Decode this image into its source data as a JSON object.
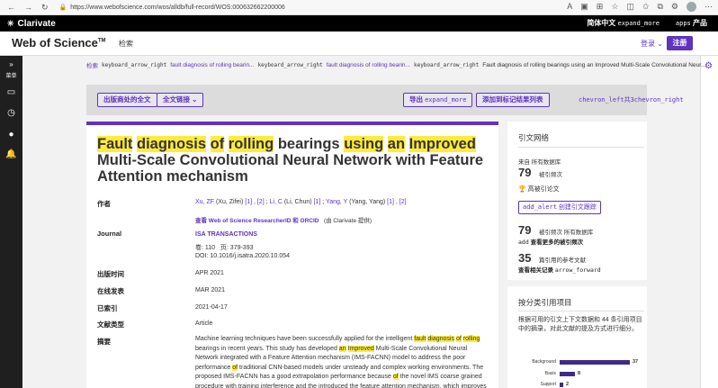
{
  "browser": {
    "url": "https://www.webofscience.com/wos/alldb/full-record/WOS:000632662200006"
  },
  "clarivate": {
    "logo": "Clarivate",
    "lang_label": "简体中文",
    "lang_icon": "expand_more",
    "apps_icon": "apps",
    "apps_label": "产品"
  },
  "header": {
    "logo": "Web of Science",
    "logo_tm": "TM",
    "search_nav": "检索",
    "login_label": "登录",
    "register_label": "注册"
  },
  "sidebar": {
    "menu_label": "菜单"
  },
  "breadcrumb": {
    "home": "检索",
    "sep1": "keyboard_arrow_right",
    "crumb1": "fault diagnosis of rolling bearin...",
    "sep2": "keyboard_arrow_right",
    "crumb2": "fault diagnosis of rolling bearin...",
    "sep3": "keyboard_arrow_right",
    "current": "Fault diagnosis of rolling bearings using an Improved Multi-Scale Convolutional Neur..."
  },
  "toolbar": {
    "publisher_fulltext": "出版商处的全文",
    "fulltext_links": "全文链接",
    "export": "导出",
    "export_icon": "expand_more",
    "add_marked": "添加到标记结果列表",
    "pager": "chevron_left共3chevron_right"
  },
  "record": {
    "title_parts": {
      "p1": "Fault",
      "p2": "diagnosis",
      "p3": "of",
      "p4": "rolling",
      "p5": "bearings",
      "p6": "using",
      "p7": "an",
      "p8": "Improved",
      "p9": "Multi-Scale Convolutional Neural Network with Feature Attention mechanism"
    },
    "authors_label": "作者",
    "authors": {
      "a1": "Xu, ZF",
      "a1_full": " (Xu, Zifei) ",
      "a1_refs": "[1] , [2]",
      "a2": "Li, C",
      "a2_full": " (Li, Chun) ",
      "a2_refs": "[1]",
      "a3": "Yang, Y",
      "a3_full": " (Yang, Yang) ",
      "a3_refs": "[1] , [2]",
      "researcher_link": "查看 Web of Science ResearcherID 和 ORCID",
      "provider": "(由 Clarivate 提供)"
    },
    "journal_label": "Journal",
    "journal_name": "ISA TRANSACTIONS",
    "volume": "卷: 110",
    "pages": "页: 379-393",
    "doi": "DOI: 10.1016/j.isatra.2020.10.054",
    "pub_date_label": "出版时间",
    "pub_date": "APR 2021",
    "early_access_label": "在线发表",
    "early_access": "MAR 2021",
    "indexed_label": "已索引",
    "indexed": "2021-04-17",
    "doc_type_label": "文献类型",
    "doc_type": "Article",
    "abstract_label": "摘要",
    "abstract": {
      "t1": "Machine learning techniques have been successfully applied for the intelligent ",
      "h1": "fault",
      "t2": " ",
      "h2": "diagnosis",
      "t3": " ",
      "h3": "of",
      "t4": " ",
      "h4": "rolling",
      "t5": " bearings in recent years. This study has developed ",
      "h5": "an",
      "t6": " ",
      "h6": "Improved",
      "t7": " Multi-Scale Convolutional Neural Network integrated with a Feature Attention mechanism (IMS-FACNN) model to address the poor performance ",
      "h7": "of",
      "t8": " traditional CNN-based models under unsteady and complex working environments. The proposed IMS-FACNN has a good extrapolation performance because ",
      "h8": "of",
      "t9": " the novel IMS coarse grained procedure with training interference and the introduced the feature attention mechanism, which improves the model's generalization ability. The proposed IMS-FACNN"
    }
  },
  "citation": {
    "title": "引文网络",
    "source_label": "来自 所有数据库",
    "times_cited": "79",
    "times_cited_label": "被引频次",
    "highly_cited": "高被引论文",
    "alert_icon": "add_alert",
    "alert_label": "创建引文跟踪",
    "all_db_count": "79",
    "all_db_label": "被引频次 所有数据库",
    "more_counts_icon": "add",
    "more_counts_label": "查看更多的被引频次",
    "refs_count": "35",
    "refs_label": "篇引用的参考文献",
    "related_label": "查看相关记录",
    "related_icon": "arrow_forward"
  },
  "classified": {
    "title": "按分类引用项目",
    "desc": "根据可用的引文上下文数据和 44 条引用项目中的摘录，对此文献的提及方式进行细分。",
    "bars": [
      {
        "label": "Background",
        "value": 37
      },
      {
        "label": "Basis",
        "value": 8
      },
      {
        "label": "Support",
        "value": 2
      }
    ]
  },
  "colors": {
    "brand_purple": "#5e33bf",
    "highlight": "#ffeb3b",
    "bar": "#3f2a8c"
  }
}
